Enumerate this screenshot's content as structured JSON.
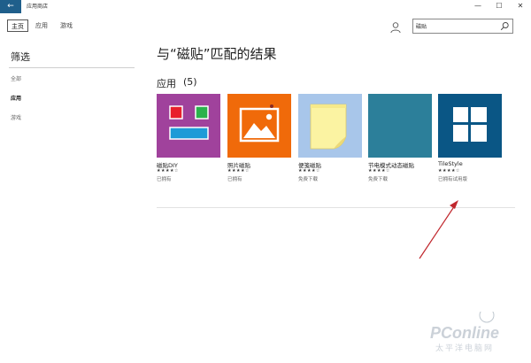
{
  "window": {
    "back_glyph": "←",
    "title": "应用商店",
    "minimize": "—",
    "maximize": "☐",
    "close": "✕"
  },
  "nav": {
    "tabs": [
      "主页",
      "应用",
      "游戏"
    ],
    "active_index": 0
  },
  "search": {
    "value": "磁贴",
    "icon": "search-icon"
  },
  "user_icon": "user-icon",
  "sidebar": {
    "title": "筛选",
    "items": [
      "全部",
      "应用",
      "游戏"
    ],
    "selected_index": 1
  },
  "main": {
    "heading": "与“磁贴”匹配的结果",
    "section_title": "应用",
    "section_count": "(5)"
  },
  "apps": [
    {
      "name": "磁贴DIY",
      "stars": "★★★★☆",
      "price": "已拥有",
      "tile_color": "#a0429c",
      "icon": "tile-diy-icon"
    },
    {
      "name": "照片磁贴",
      "stars": "★★★★☆",
      "price": "已拥有",
      "tile_color": "#f06a0a",
      "icon": "photo-icon"
    },
    {
      "name": "便笺磁贴",
      "stars": "★★★★☆",
      "price": "免费下载",
      "tile_color": "#a8c6ea",
      "icon": "sticky-note-icon"
    },
    {
      "name": "节电模式动态磁贴",
      "stars": "★★★★☆",
      "price": "免费下载",
      "tile_color": "#2c7f9a",
      "icon": "blank-tile-icon"
    },
    {
      "name": "TileStyle",
      "stars": "★★★★☆",
      "price": "已拥有试用版",
      "tile_color": "#0a5685",
      "icon": "windows-logo-icon"
    }
  ],
  "watermark": {
    "text": "PConline",
    "subtext": "太平洋电脑网"
  },
  "colors": {
    "accent": "#1f5f8b",
    "annotation_arrow": "#c0272d"
  }
}
